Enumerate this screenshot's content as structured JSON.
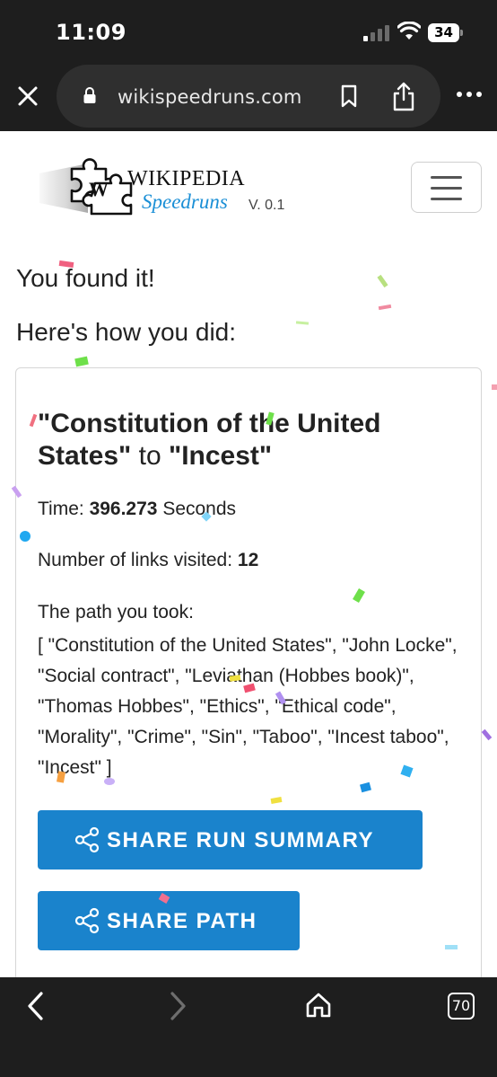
{
  "status_bar": {
    "time": "11:09",
    "battery": "34"
  },
  "browser": {
    "url": "wikispeedruns.com",
    "tab_count": "70"
  },
  "site": {
    "logo_wikipedia": "WIKIPEDIA",
    "logo_speedruns": "Speedruns",
    "version": "V. 0.1"
  },
  "result": {
    "found": "You found it!",
    "how": "Here's how you did:",
    "start_article": "\"Constitution of the United States\"",
    "connector": " to ",
    "end_article": "\"Incest\"",
    "time_label": "Time: ",
    "time_value": "396.273",
    "time_unit": " Seconds",
    "links_label": "Number of links visited: ",
    "links_value": "12",
    "path_label": "The path you took:",
    "path_text": "[ \"Constitution of the United States\", \"John Locke\", \"Social contract\", \"Leviathan (Hobbes book)\", \"Thomas Hobbes\", \"Ethics\", \"Ethical code\", \"Morality\", \"Crime\", \"Sin\", \"Taboo\", \"Incest taboo\", \"Incest\" ]"
  },
  "buttons": {
    "share_summary": "SHARE RUN SUMMARY",
    "share_path": "SHARE PATH"
  },
  "colors": {
    "accent": "#1a83cc",
    "speedruns_blue": "#1a8fd6",
    "chrome_dark": "#1e1e1e"
  }
}
